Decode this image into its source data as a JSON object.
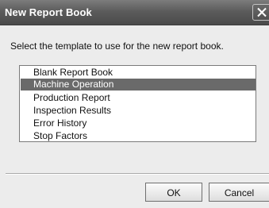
{
  "window": {
    "title": "New Report Book"
  },
  "prompt": "Select the template to use for the new report book.",
  "templates": {
    "selected": "Machine Operation",
    "items": [
      "Blank Report Book",
      "Machine Operation",
      "Production Report",
      "Inspection Results",
      "Error History",
      "Stop Factors"
    ]
  },
  "buttons": {
    "ok": "OK",
    "cancel": "Cancel"
  },
  "icons": {
    "close": "close-icon"
  },
  "colors": {
    "titlebar": "#5c5c5c",
    "selection": "#6a6a6a",
    "dialog_bg": "#ececec"
  }
}
